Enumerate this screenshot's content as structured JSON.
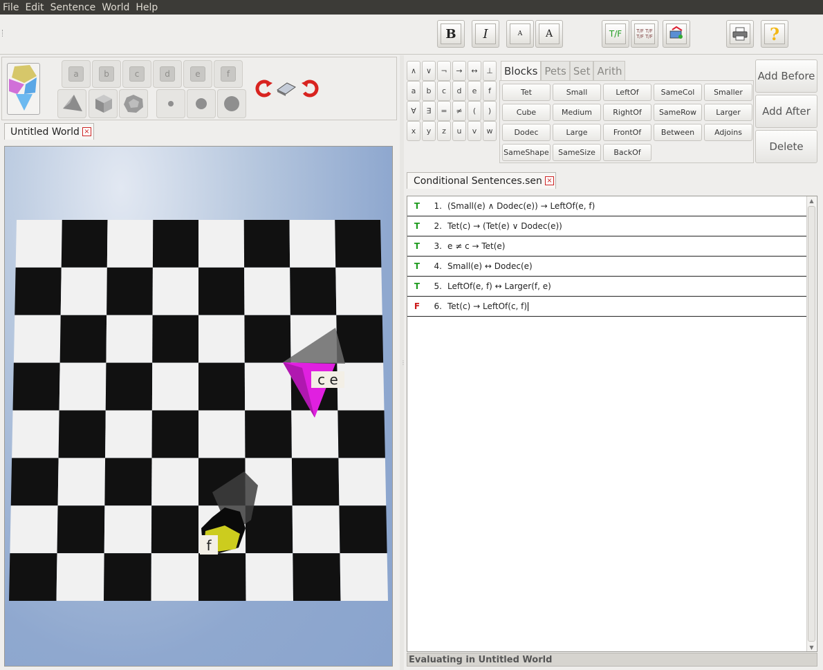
{
  "menu": [
    "File",
    "Edit",
    "Sentence",
    "World",
    "Help"
  ],
  "toolbar": {
    "bold": "B",
    "italic": "I",
    "font_small": "A",
    "font_large": "A",
    "verify": "T/F",
    "verify_all": "T/F T/F T/F T/F"
  },
  "block_names": [
    "a",
    "b",
    "c",
    "d",
    "e",
    "f"
  ],
  "world_tab": {
    "title": "Untitled World",
    "close": "×"
  },
  "world": {
    "labels": {
      "tet": "c e",
      "dodec": "f"
    },
    "colors": {
      "tet": "#e020e0",
      "dodec": "#cccc1e"
    }
  },
  "keypad": [
    [
      "∧",
      "∨",
      "¬",
      "→",
      "↔",
      "⊥"
    ],
    [
      "a",
      "b",
      "c",
      "d",
      "e",
      "f"
    ],
    [
      "∀",
      "∃",
      "=",
      "≠",
      "(",
      ")"
    ],
    [
      "x",
      "y",
      "z",
      "u",
      "v",
      "w"
    ]
  ],
  "predicate_tabs": [
    "Blocks",
    "Pets",
    "Set",
    "Arith"
  ],
  "predicates": [
    [
      "Tet",
      "Small",
      "LeftOf",
      "SameCol",
      "Smaller"
    ],
    [
      "Cube",
      "Medium",
      "RightOf",
      "SameRow",
      "Larger"
    ],
    [
      "Dodec",
      "Large",
      "FrontOf",
      "Between",
      "Adjoins"
    ],
    [
      "SameShape",
      "SameSize",
      "BackOf"
    ]
  ],
  "side_buttons": {
    "add_before": "Add Before",
    "add_after": "Add After",
    "delete": "Delete"
  },
  "sentence_tab": {
    "title": "Conditional Sentences.sen",
    "close": "×"
  },
  "sentences": [
    {
      "tv": "T",
      "num": "1.",
      "text": "(Small(e) ∧ Dodec(e)) → LeftOf(e, f)"
    },
    {
      "tv": "T",
      "num": "2.",
      "text": "Tet(c) → (Tet(e) ∨ Dodec(e))"
    },
    {
      "tv": "T",
      "num": "3.",
      "text": "e ≠ c → Tet(e)"
    },
    {
      "tv": "T",
      "num": "4.",
      "text": "Small(e) ↔ Dodec(e)"
    },
    {
      "tv": "T",
      "num": "5.",
      "text": "LeftOf(e, f) ↔ Larger(f, e)"
    },
    {
      "tv": "F",
      "num": "6.",
      "text": "Tet(c) → LeftOf(c, f)"
    }
  ],
  "colors": {
    "true": "#1e9a1e",
    "false": "#cc1a1a"
  },
  "status": "Evaluating in Untitled World"
}
